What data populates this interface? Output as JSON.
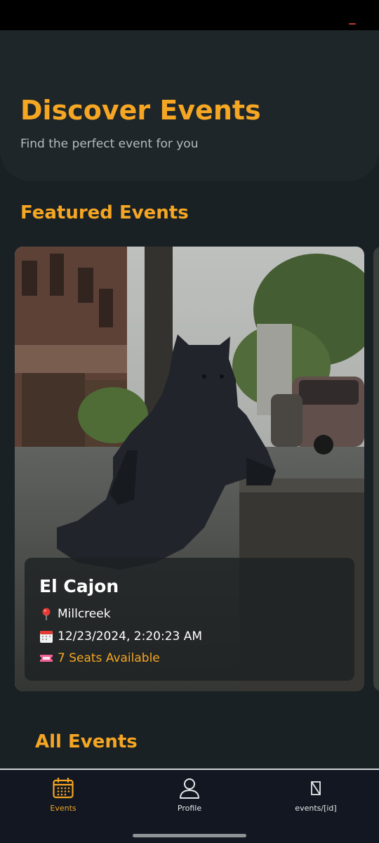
{
  "header": {
    "title": "Discover Events",
    "subtitle": "Find the perfect event for you"
  },
  "sections": {
    "featured_title": "Featured Events",
    "all_title": "All Events"
  },
  "featured_event": {
    "name": "El Cajon",
    "location": "Millcreek",
    "datetime": "12/23/2024, 2:20:23 AM",
    "seats": "7 Seats Available",
    "location_icon": "pin-icon",
    "date_icon": "calendar-icon",
    "seats_icon": "ticket-icon",
    "image": "cat-statue-photo"
  },
  "bottom_nav": {
    "tabs": [
      {
        "label": "Events",
        "icon": "calendar-grid-icon",
        "active": true
      },
      {
        "label": "Profile",
        "icon": "person-icon",
        "active": false
      },
      {
        "label": "events/[id]",
        "icon": "missing-glyph-icon",
        "active": false
      }
    ]
  },
  "colors": {
    "accent": "#f5a623",
    "background": "#1a2124",
    "nav_background": "#121721"
  }
}
